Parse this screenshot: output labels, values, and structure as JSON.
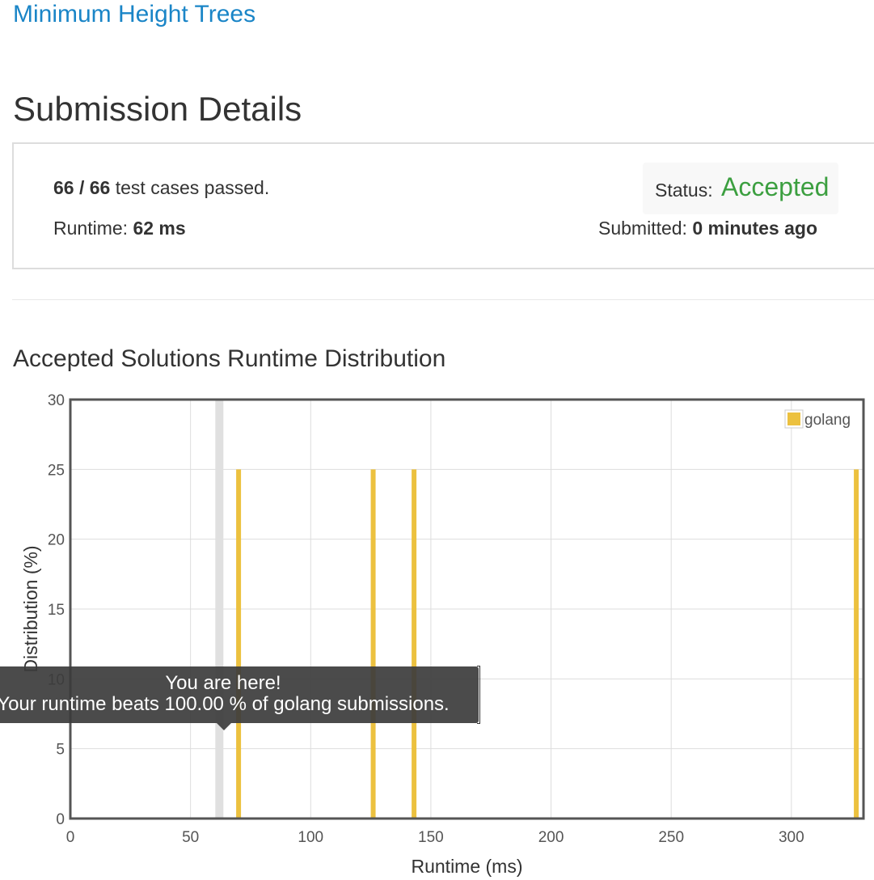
{
  "header": {
    "problem_title": "Minimum Height Trees",
    "page_title": "Submission Details"
  },
  "details": {
    "tests_passed": "66 / 66",
    "tests_suffix": "test cases passed.",
    "runtime_label": "Runtime:",
    "runtime_value": "62 ms",
    "status_label": "Status:",
    "status_value": "Accepted",
    "submitted_label": "Submitted:",
    "submitted_value": "0 minutes ago"
  },
  "colors": {
    "link": "#1a85c7",
    "accepted": "#3c9f40",
    "bar": "#ecc13f",
    "marker": "#e0e0e0"
  },
  "distribution_title": "Accepted Solutions Runtime Distribution",
  "tooltip": {
    "line1": "You are here!",
    "line2": "Your runtime beats 100.00 % of golang submissions."
  },
  "chart_data": {
    "type": "bar",
    "title": "",
    "xlabel": "Runtime (ms)",
    "ylabel": "Distribution (%)",
    "xlim": [
      0,
      330
    ],
    "ylim": [
      0,
      30
    ],
    "x_ticks": [
      0,
      50,
      100,
      150,
      200,
      250,
      300
    ],
    "y_ticks": [
      0,
      5,
      10,
      15,
      20,
      25,
      30
    ],
    "grid": true,
    "legend": "top-right",
    "series": [
      {
        "name": "golang",
        "x": [
          70,
          126,
          143,
          327
        ],
        "values": [
          25,
          25,
          25,
          25
        ]
      }
    ],
    "your_runtime": 62
  }
}
